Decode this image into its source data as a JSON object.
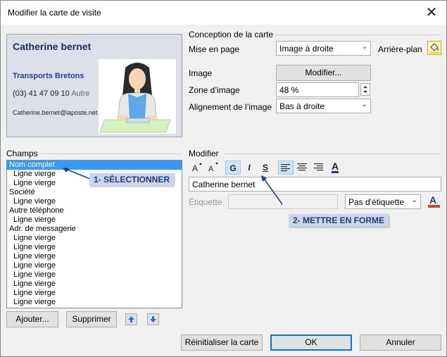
{
  "window": {
    "title": "Modifier la carte de visite",
    "close_glyph": "✕"
  },
  "card": {
    "name": "Catherine bernet",
    "company": "Transports Bretons",
    "phone": "(03) 41 47 09 10",
    "phone_label": "Autre",
    "email": "Catherine.bernet@laposte.net"
  },
  "design": {
    "section_title": "Conception de la carte",
    "layout_label": "Mise en page",
    "layout_value": "Image à droite",
    "background_label": "Arrière-plan",
    "image_label": "Image",
    "image_button": "Modifier...",
    "zone_label": "Zone d’image",
    "zone_value": "48 %",
    "align_label": "Alignement de l’image",
    "align_value": "Bas à droite"
  },
  "fields": {
    "section_title": "Champs",
    "items": [
      {
        "label": "Nom complet",
        "selected": true
      },
      {
        "label": "Ligne vierge"
      },
      {
        "label": "Ligne vierge"
      },
      {
        "label": "Société"
      },
      {
        "label": "Ligne vierge"
      },
      {
        "label": "Autre téléphone"
      },
      {
        "label": "Ligne vierge"
      },
      {
        "label": "Adr. de messagerie"
      },
      {
        "label": "Ligne vierge"
      },
      {
        "label": "Ligne vierge"
      },
      {
        "label": "Ligne vierge"
      },
      {
        "label": "Ligne vierge"
      },
      {
        "label": "Ligne vierge"
      },
      {
        "label": "Ligne vierge"
      },
      {
        "label": "Ligne vierge"
      },
      {
        "label": "Ligne vierge"
      }
    ],
    "add_button": "Ajouter...",
    "delete_button": "Supprimer"
  },
  "edit": {
    "section_title": "Modifier",
    "bold": "G",
    "italic": "I",
    "underline": "S",
    "font_color": "A",
    "text_value": "Catherine bernet",
    "label_label": "Étiquette",
    "label_select": "Pas d'étiquette"
  },
  "callouts": {
    "select": "1- SÉLECTIONNER",
    "format": "2- METTRE EN FORME"
  },
  "footer": {
    "reset_button": "Réinitialiser la carte",
    "ok_button": "OK",
    "cancel_button": "Annuler"
  },
  "colors": {
    "selection": "#3399ff",
    "callout_text": "#1f3b7a",
    "card_name": "#1c2d63"
  }
}
